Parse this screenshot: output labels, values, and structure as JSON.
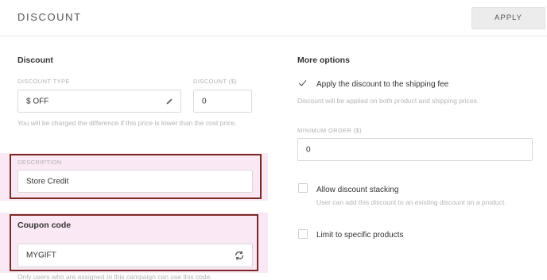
{
  "header": {
    "title": "DISCOUNT",
    "apply_label": "APPLY"
  },
  "discount": {
    "section_title": "Discount",
    "type_label": "DISCOUNT TYPE",
    "type_value": "$ OFF",
    "amount_label": "DISCOUNT ($)",
    "amount_value": "0",
    "hint": "You will be charged the difference if this price is lower than the cost price.",
    "description_label": "DESCRIPTION",
    "description_value": "Store Credit"
  },
  "coupon": {
    "section_title": "Coupon code",
    "value": "MYGIFT",
    "hint": "Only users who are assigned to this campaign can use this code."
  },
  "more_options": {
    "section_title": "More options",
    "shipping": {
      "label": "Apply the discount to the shipping fee",
      "checked": true,
      "hint": "Discount will be applied on both product and shipping prices."
    },
    "min_order_label": "MINIMUM ORDER ($)",
    "min_order_value": "0",
    "stacking": {
      "label": "Allow discount stacking",
      "checked": false,
      "hint": "User can add this discount to an existing discount on a product."
    },
    "limit": {
      "label": "Limit to specific products",
      "checked": false
    }
  },
  "icons": {
    "edit": "pencil-icon",
    "regenerate": "refresh-icon",
    "check": "checkmark-icon"
  },
  "colors": {
    "highlight": "#fbe8f5",
    "outline": "#7a2a24"
  }
}
